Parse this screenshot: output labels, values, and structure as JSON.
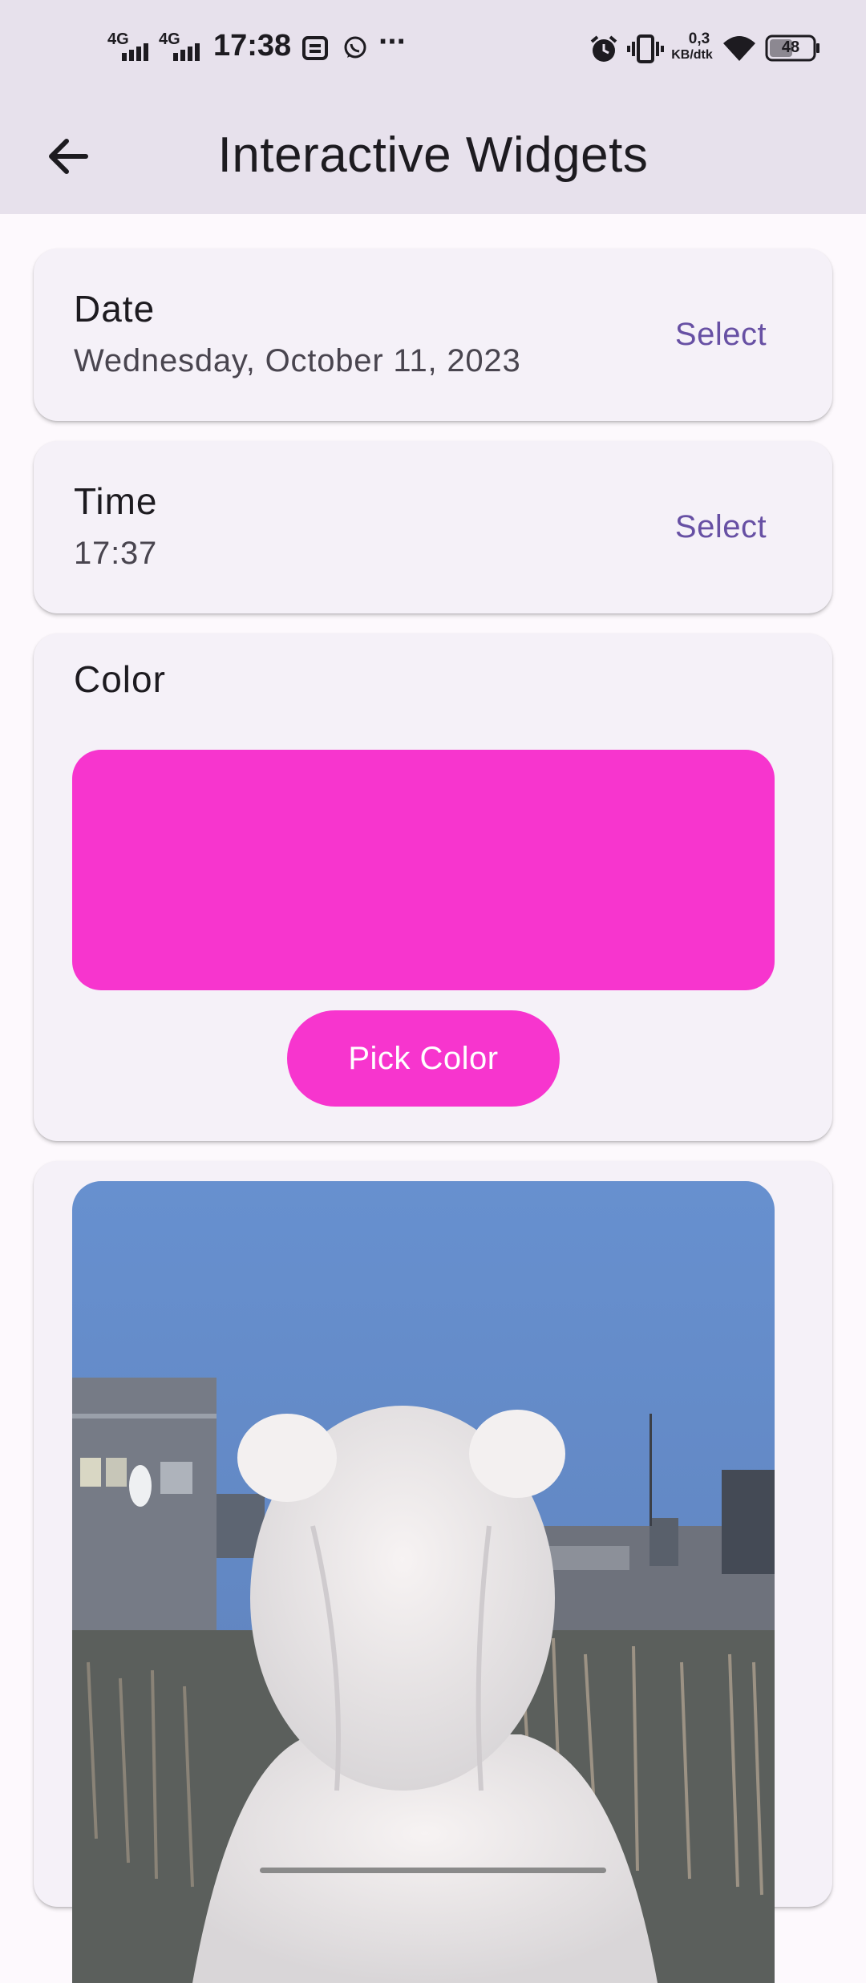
{
  "status_bar": {
    "network_1": "4G",
    "network_2": "4G",
    "time": "17:38",
    "data_rate_value": "0,3",
    "data_rate_unit": "KB/dtk",
    "battery": "48",
    "overflow": "···"
  },
  "app_bar": {
    "title": "Interactive Widgets"
  },
  "date_card": {
    "title": "Date",
    "value": "Wednesday, October 11, 2023",
    "action_label": "Select"
  },
  "time_card": {
    "title": "Time",
    "value": "17:37",
    "action_label": "Select"
  },
  "color_card": {
    "title": "Color",
    "selected_color": "#f735ce",
    "button_label": "Pick Color"
  },
  "colors": {
    "accent": "#6750a4",
    "app_bar_bg": "#e7e1ec",
    "card_bg": "#f5f1f8",
    "picked": "#f735ce"
  },
  "icons": {
    "back": "arrow-left-icon",
    "alarm": "alarm-icon",
    "vibrate": "vibrate-icon",
    "wifi": "wifi-icon",
    "battery": "battery-icon",
    "whatsapp": "whatsapp-icon",
    "message": "message-icon"
  }
}
